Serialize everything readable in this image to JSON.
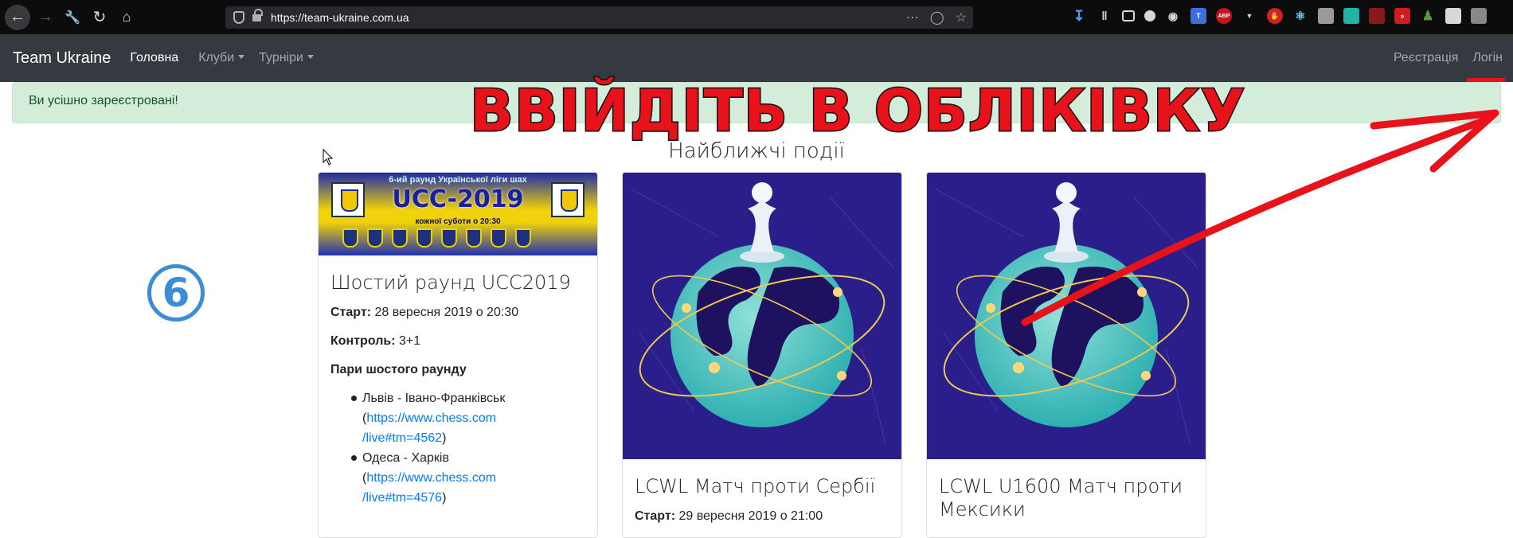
{
  "browser": {
    "url": "https://team-ukraine.com.ua"
  },
  "navbar": {
    "brand": "Team Ukraine",
    "items": [
      {
        "label": "Головна"
      },
      {
        "label": "Клуби"
      },
      {
        "label": "Турніри"
      }
    ],
    "right": [
      {
        "label": "Реєстрація"
      },
      {
        "label": "Логін"
      }
    ]
  },
  "alert": {
    "text": "Ви усішно зареєстровані!"
  },
  "section": {
    "title": "Найближчі події"
  },
  "cards": [
    {
      "title": "Шостий раунд UCC2019",
      "start_label": "Старт:",
      "start_value": " 28 вересня 2019 о 20:30",
      "control_label": "Контроль:",
      "control_value": " 3+1",
      "pairs_heading": "Пари шостого раунду",
      "pairs": [
        {
          "text": "Львів - Івано-Франківськ",
          "open": "(",
          "link": "https://www.chess.com/live#tm=4562",
          "link_line1": "https://www.chess.com",
          "link_line2": "/live#tm=4562",
          "close": ")"
        },
        {
          "text": "Одеса - Харків",
          "open": "(",
          "link": "https://www.chess.com/live#tm=4576",
          "link_line1": "https://www.chess.com",
          "link_line2": "/live#tm=4576",
          "close": ")"
        }
      ],
      "banner": {
        "top": "6-ий раунд Української ліги шах",
        "title": "UCC-2019",
        "bottom": "кожної суботи о 20:30"
      }
    },
    {
      "title": "LCWL Матч проти Сербії",
      "start_label": "Старт:",
      "start_value": " 29 вересня 2019 о 21:00"
    },
    {
      "title": "LCWL U1600 Матч проти Мексики"
    }
  ],
  "overlay": {
    "caption": "ВВІЙДІТЬ В ОБЛІКІВКУ",
    "number": "⑥",
    "colors": {
      "caption": "#e8121a",
      "number": "#3b8ed6",
      "arrow": "#e8121a"
    }
  },
  "colors": {
    "navbar_bg": "#343a40",
    "alert_bg": "#d4edda",
    "alert_text": "#155724",
    "link": "#007bff"
  }
}
